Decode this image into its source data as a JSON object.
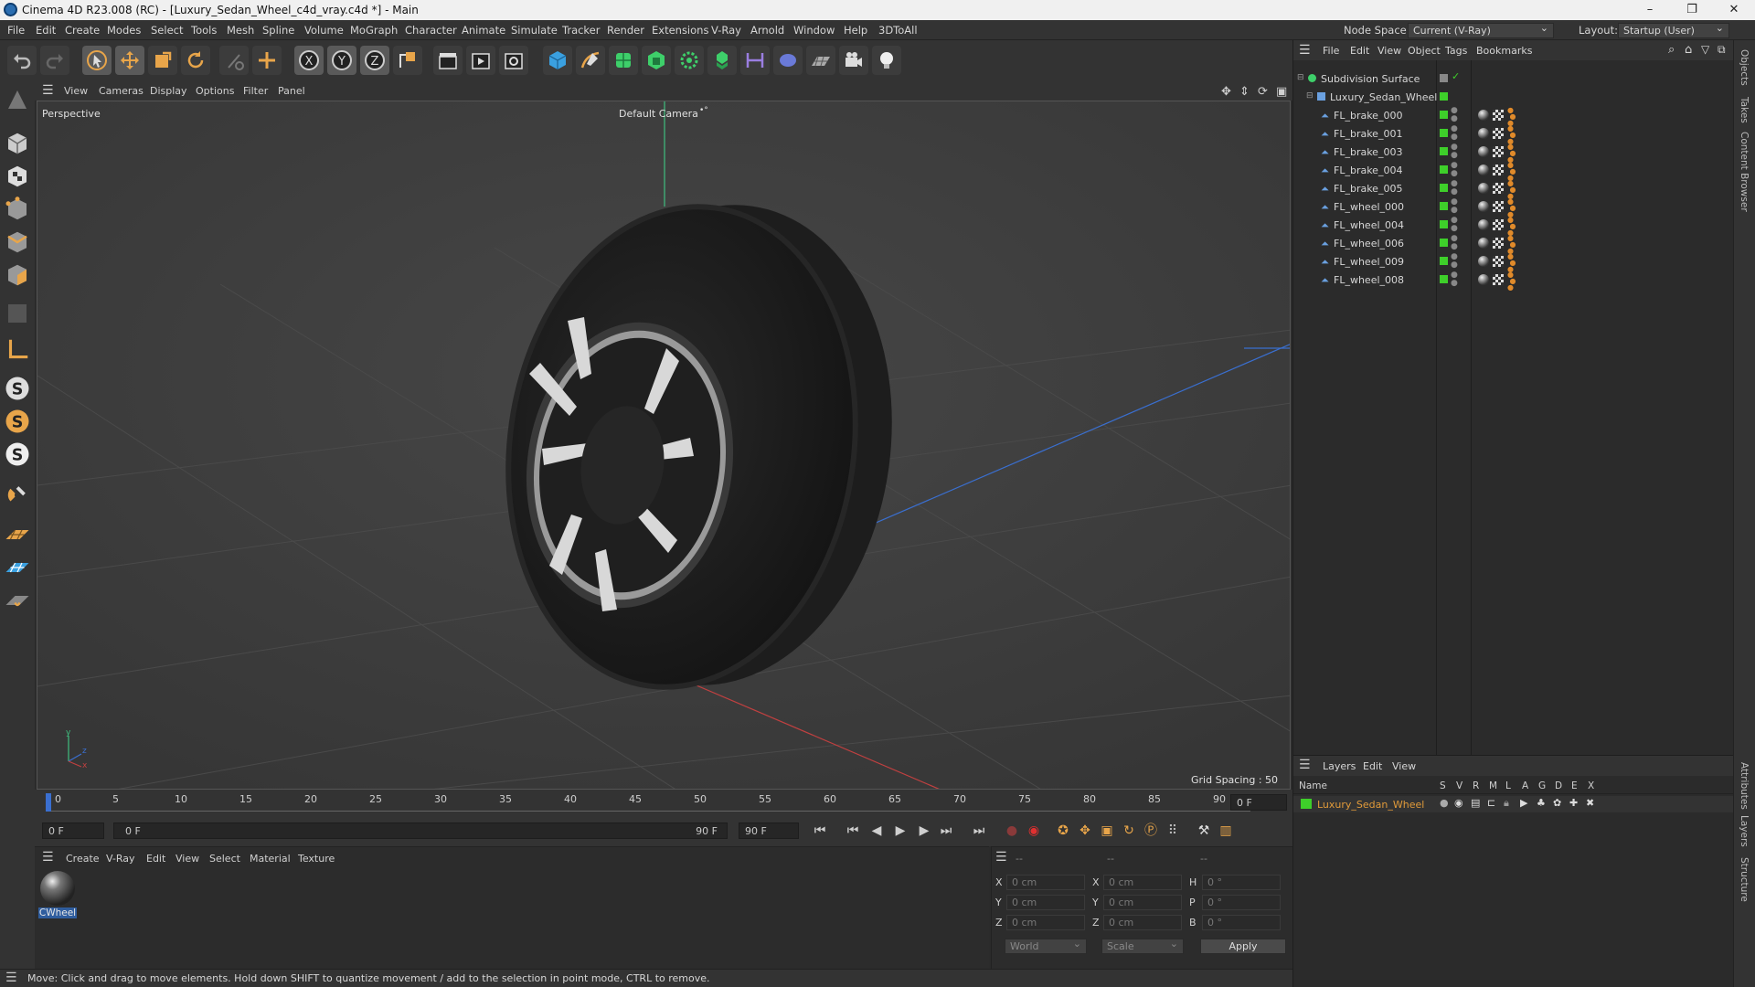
{
  "window": {
    "title": "Cinema 4D R23.008 (RC) - [Luxury_Sedan_Wheel_c4d_vray.c4d *] - Main",
    "minimize": "–",
    "maximize": "❐",
    "close": "✕"
  },
  "menubar": {
    "items": [
      "File",
      "Edit",
      "Create",
      "Modes",
      "Select",
      "Tools",
      "Mesh",
      "Spline",
      "Volume",
      "MoGraph",
      "Character",
      "Animate",
      "Simulate",
      "Tracker",
      "Render",
      "Extensions",
      "V-Ray",
      "Arnold",
      "Window",
      "Help",
      "3DToAll"
    ],
    "node_space_label": "Node Space:",
    "node_space_value": "Current (V-Ray)",
    "layout_label": "Layout:",
    "layout_value": "Startup (User)"
  },
  "viewport": {
    "menu": [
      "View",
      "Cameras",
      "Display",
      "Options",
      "Filter",
      "Panel"
    ],
    "view_name": "Perspective",
    "camera_label": "Default Camera",
    "grid_spacing": "Grid Spacing : 50 cm",
    "axis_y": "y",
    "axis_z": "z",
    "axis_x": "x"
  },
  "timeline": {
    "ticks": [
      "0",
      "5",
      "10",
      "15",
      "20",
      "25",
      "30",
      "35",
      "40",
      "45",
      "50",
      "55",
      "60",
      "65",
      "70",
      "75",
      "80",
      "85",
      "90"
    ],
    "current_frame": "0 F"
  },
  "transport": {
    "start_field": "0 F",
    "range_start": "0 F",
    "range_end": "90 F",
    "end_field": "90 F"
  },
  "material_manager": {
    "menu": [
      "Create",
      "V-Ray",
      "Edit",
      "View",
      "Select",
      "Material",
      "Texture"
    ],
    "materials": [
      {
        "name": "CWheel"
      }
    ]
  },
  "coordinates": {
    "headers": [
      "--",
      "--",
      "--"
    ],
    "rows": [
      {
        "a": "X",
        "av": "0 cm",
        "b": "X",
        "bv": "0 cm",
        "c": "H",
        "cv": "0 °"
      },
      {
        "a": "Y",
        "av": "0 cm",
        "b": "Y",
        "bv": "0 cm",
        "c": "P",
        "cv": "0 °"
      },
      {
        "a": "Z",
        "av": "0 cm",
        "b": "Z",
        "bv": "0 cm",
        "c": "B",
        "cv": "0 °"
      }
    ],
    "space": "World",
    "mode": "Scale",
    "apply": "Apply"
  },
  "status": "Move: Click and drag to move elements. Hold down SHIFT to quantize movement / add to the selection in point mode, CTRL to remove.",
  "objects_panel": {
    "menu": [
      "File",
      "Edit",
      "View",
      "Object",
      "Tags",
      "Bookmarks"
    ],
    "root": "Subdivision Surface",
    "group": "Luxury_Sedan_Wheel",
    "children": [
      "FL_brake_000",
      "FL_brake_001",
      "FL_brake_003",
      "FL_brake_004",
      "FL_brake_005",
      "FL_wheel_000",
      "FL_wheel_004",
      "FL_wheel_006",
      "FL_wheel_009",
      "FL_wheel_008"
    ]
  },
  "layers_panel": {
    "menu": [
      "Layers",
      "Edit",
      "View"
    ],
    "columns": [
      "Name",
      "S",
      "V",
      "R",
      "M",
      "L",
      "A",
      "G",
      "D",
      "E",
      "X"
    ],
    "layers": [
      {
        "name": "Luxury_Sedan_Wheel",
        "color": "#3ecf2a"
      }
    ]
  },
  "side_tabs": [
    "Objects",
    "Takes",
    "Content Browser",
    "Attributes",
    "Layers",
    "Structure"
  ],
  "colors": {
    "accent_green": "#3ecf2a",
    "layer_name": "#e09a3a",
    "orange_tag": "#e08a2a"
  }
}
